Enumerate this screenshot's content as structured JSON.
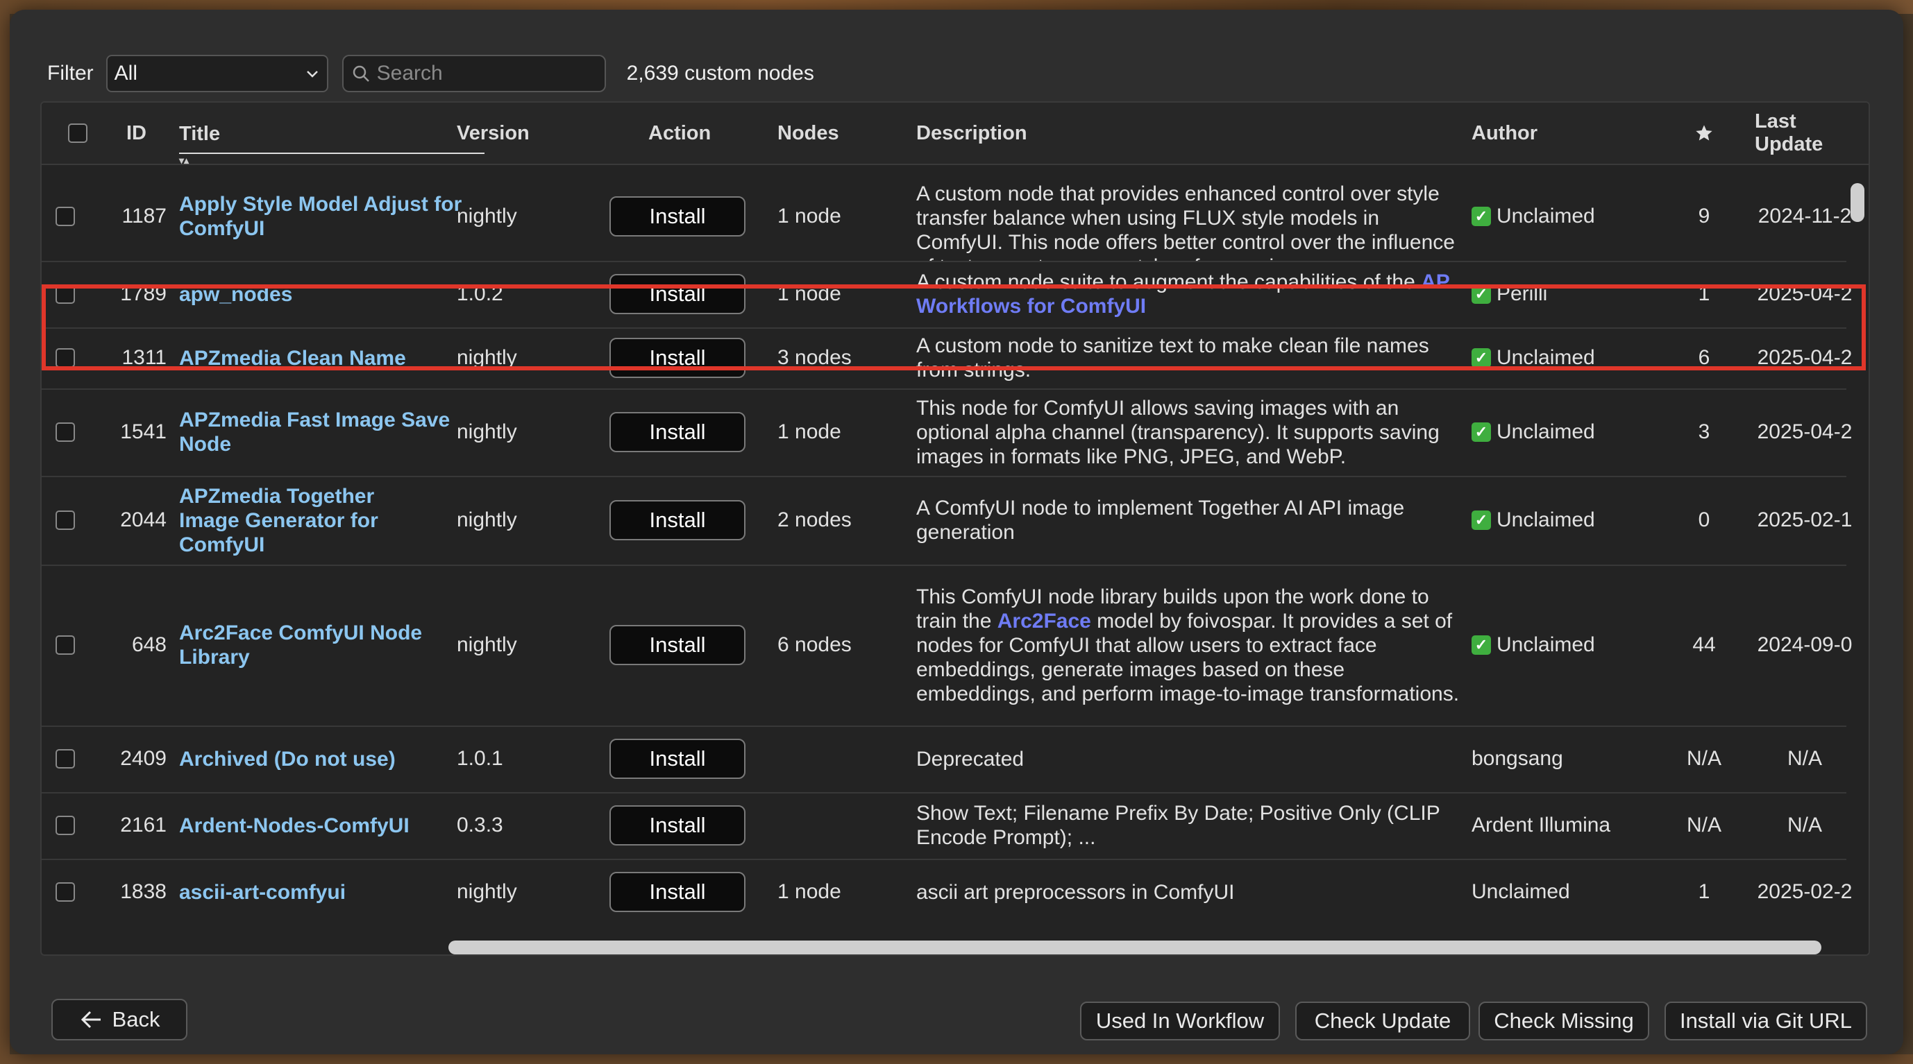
{
  "toolbar": {
    "filter_label": "Filter",
    "filter_value": "All",
    "search_placeholder": "Search",
    "count_text": "2,639 custom nodes"
  },
  "table": {
    "headers": {
      "id": "ID",
      "title": "Title",
      "version": "Version",
      "action": "Action",
      "nodes": "Nodes",
      "description": "Description",
      "author": "Author",
      "stars": "★",
      "last_update": "Last Update"
    },
    "rows": [
      {
        "id": "1187",
        "title": "Apply Style Model Adjust for ComfyUI",
        "version": "nightly",
        "action": "Install",
        "nodes": "1 node",
        "description": "A custom node that provides enhanced control over style transfer balance when using FLUX style models in ComfyUI. This node offers better control over the influence of text prompts versus style reference images",
        "author": "Unclaimed",
        "verified": true,
        "stars": "9",
        "last_update": "2024-11-2"
      },
      {
        "id": "1789",
        "title": "apw_nodes",
        "version": "1.0.2",
        "action": "Install",
        "nodes": "1 node",
        "description": "A custom node suite to augment the capabilities of the ",
        "description_link": "AP Workflows for ComfyUI",
        "author": "Perilli",
        "verified": true,
        "stars": "1",
        "last_update": "2025-04-2"
      },
      {
        "id": "1311",
        "title": "APZmedia Clean Name",
        "version": "nightly",
        "action": "Install",
        "nodes": "3 nodes",
        "description": "A custom node to sanitize text to make clean file names from strings.",
        "author": "Unclaimed",
        "verified": true,
        "stars": "6",
        "last_update": "2025-04-2"
      },
      {
        "id": "1541",
        "title": "APZmedia Fast Image Save Node",
        "version": "nightly",
        "action": "Install",
        "nodes": "1 node",
        "description": "This node for ComfyUI allows saving images with an optional alpha channel (transparency). It supports saving images in formats like PNG, JPEG, and WebP.",
        "author": "Unclaimed",
        "verified": true,
        "stars": "3",
        "last_update": "2025-04-2"
      },
      {
        "id": "2044",
        "title": "APZmedia Together Image Generator for ComfyUI",
        "version": "nightly",
        "action": "Install",
        "nodes": "2 nodes",
        "description": "A ComfyUI node to implement Together AI API image generation",
        "author": "Unclaimed",
        "verified": true,
        "stars": "0",
        "last_update": "2025-02-1"
      },
      {
        "id": "648",
        "title": "Arc2Face ComfyUI Node Library",
        "version": "nightly",
        "action": "Install",
        "nodes": "6 nodes",
        "description_pre": "This ComfyUI node library builds upon the work done to train the ",
        "description_link": "Arc2Face",
        "description_post": " model by foivospar. It provides a set of nodes for ComfyUI that allow users to extract face embeddings, generate images based on these embeddings, and perform image-to-image transformations.",
        "author": "Unclaimed",
        "verified": true,
        "stars": "44",
        "last_update": "2024-09-0"
      },
      {
        "id": "2409",
        "title": "Archived (Do not use)",
        "version": "1.0.1",
        "action": "Install",
        "nodes": "",
        "description": "Deprecated",
        "author": "bongsang",
        "verified": false,
        "stars": "N/A",
        "last_update": "N/A"
      },
      {
        "id": "2161",
        "title": "Ardent-Nodes-ComfyUI",
        "version": "0.3.3",
        "action": "Install",
        "nodes": "",
        "description": "Show Text; Filename Prefix By Date; Positive Only (CLIP Encode Prompt); ...",
        "author": "Ardent Illumina",
        "verified": false,
        "stars": "N/A",
        "last_update": "N/A"
      },
      {
        "id": "1838",
        "title": "ascii-art-comfyui",
        "version": "nightly",
        "action": "Install",
        "nodes": "1 node",
        "description": "ascii art preprocessors in ComfyUI",
        "author": "Unclaimed",
        "verified": false,
        "stars": "1",
        "last_update": "2025-02-2"
      }
    ]
  },
  "footer": {
    "back_label": "Back",
    "used_in_workflow": "Used In Workflow",
    "check_update": "Check Update",
    "check_missing": "Check Missing",
    "install_git_url": "Install via Git URL"
  },
  "colors": {
    "title_link": "#8cc6f0",
    "desc_link": "#6f7cf5",
    "highlight": "#e0362a",
    "verified": "#3fae3f"
  }
}
